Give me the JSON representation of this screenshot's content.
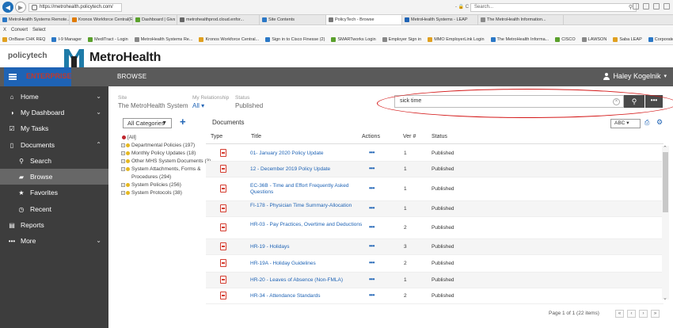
{
  "browser": {
    "url": "https://metrohealth.policytech.com/",
    "search_placeholder": "Search...",
    "url_controls": "- 🔒 C",
    "tabs": [
      {
        "label": "MetroHealth Systems Remote...",
        "color": "#2b78c6"
      },
      {
        "label": "Kronos Workforce Central(R)",
        "color": "#e07b00"
      },
      {
        "label": "Dashboard | Givx",
        "color": "#5aa02c"
      },
      {
        "label": "metrohealthprod.cloud.enfor...",
        "color": "#666666"
      },
      {
        "label": "Site Contents",
        "color": "#2b78c6"
      },
      {
        "label": "PolicyTech - Browse",
        "color": "#777777"
      },
      {
        "label": "MetroHealth Systems - LEAP",
        "color": "#1e63b5"
      },
      {
        "label": "The MetroHealth Information...",
        "color": "#8a8a8a"
      }
    ],
    "command_items": [
      "X",
      "Convert",
      "Select"
    ],
    "favorites": [
      "OnBase CHK REQ",
      "I-9 Manager",
      "MediTract - Login",
      "MetroHealth Systems Re...",
      "Kronos Workforce Central...",
      "Sign in to Cisco Finesse (2)",
      "SMARTworks Login",
      "Employer Sign in",
      "MMO EmployerLink Login",
      "The MetroHealth Informa...",
      "CISCO",
      "LAWSON",
      "Saba LEAP",
      "Corporate Screening: Bac..."
    ]
  },
  "app": {
    "product_logo": "policytech",
    "product_tagline": "ENTERPRISE",
    "brand_name": "MetroHealth",
    "brand_color": "#1e7ba8",
    "page_title": "BROWSE",
    "user_name": "Haley Kogelnik",
    "accent": "#1e63b5"
  },
  "sidebar": {
    "items": [
      {
        "label": "Home",
        "icon": "home-icon",
        "glyph": "⌂",
        "chevron": "⌄",
        "sub": false,
        "active": false
      },
      {
        "label": "My Dashboard",
        "icon": "dashboard-icon",
        "glyph": "◑",
        "chevron": "⌄",
        "sub": false,
        "active": false
      },
      {
        "label": "My Tasks",
        "icon": "tasks-icon",
        "glyph": "☑",
        "chevron": "",
        "sub": false,
        "active": false
      },
      {
        "label": "Documents",
        "icon": "document-icon",
        "glyph": "▯",
        "chevron": "⌃",
        "sub": false,
        "active": false
      },
      {
        "label": "Search",
        "icon": "search-icon",
        "glyph": "⚲",
        "chevron": "",
        "sub": true,
        "active": false
      },
      {
        "label": "Browse",
        "icon": "folder-icon",
        "glyph": "▰",
        "chevron": "",
        "sub": true,
        "active": true
      },
      {
        "label": "Favorites",
        "icon": "star-icon",
        "glyph": "★",
        "chevron": "",
        "sub": true,
        "active": false
      },
      {
        "label": "Recent",
        "icon": "clock-icon",
        "glyph": "◷",
        "chevron": "",
        "sub": true,
        "active": false
      },
      {
        "label": "Reports",
        "icon": "reports-icon",
        "glyph": "▤",
        "chevron": "",
        "sub": false,
        "active": false
      },
      {
        "label": "More",
        "icon": "more-icon",
        "glyph": "•••",
        "chevron": "⌄",
        "sub": false,
        "active": false
      }
    ]
  },
  "filters": {
    "site_label": "Site",
    "site_value": "The MetroHealth System",
    "relationship_label": "My Relationship",
    "relationship_value": "All ▾",
    "status_label": "Status",
    "status_value": "Published"
  },
  "search": {
    "value": "sick time",
    "clear": "×",
    "button_glyph": "⚲",
    "more_glyph": "•••"
  },
  "categories": {
    "selected": "All Categories",
    "add": "+",
    "tree": [
      {
        "label": "[All]",
        "root": true
      },
      {
        "label": "Departmental Policies (197)",
        "root": false
      },
      {
        "label": "Monthly Policy Updates (18)",
        "root": false
      },
      {
        "label": "Other MHS System Documents (3)",
        "root": false
      },
      {
        "label": "System Attachments, Forms & Procedures (294)",
        "root": false
      },
      {
        "label": "System Policies (256)",
        "root": false
      },
      {
        "label": "System Protocols (38)",
        "root": false
      }
    ]
  },
  "documents": {
    "heading": "Documents",
    "sort_label": "ABC",
    "columns": [
      "Type",
      "Title",
      "Actions",
      "Ver #",
      "Status"
    ],
    "rows": [
      {
        "title": "01- January 2020 Policy Update",
        "ver": "1",
        "status": "Published"
      },
      {
        "title": "12 - December 2019 Policy Update",
        "ver": "1",
        "status": "Published"
      },
      {
        "title": "EC-36B - Time and Effort Frequently Asked Questions",
        "ver": "1",
        "status": "Published"
      },
      {
        "title": "FI-178 - Physician Time Summary-Allocation",
        "ver": "1",
        "status": "Published"
      },
      {
        "title": "HR-03 - Pay Practices, Overtime and Deductions",
        "ver": "2",
        "status": "Published"
      },
      {
        "title": "HR-19 - Holidays",
        "ver": "3",
        "status": "Published"
      },
      {
        "title": "HR-19A - Holiday Guidelines",
        "ver": "2",
        "status": "Published"
      },
      {
        "title": "HR-20 - Leaves of Absence (Non-FMLA)",
        "ver": "1",
        "status": "Published"
      },
      {
        "title": "HR-34 - Attendance Standards",
        "ver": "2",
        "status": "Published"
      }
    ],
    "actions_glyph": "•••",
    "pager": "Page 1 of 1 (22 items)",
    "pager_buttons": [
      "«",
      "‹",
      "›",
      "»"
    ]
  }
}
